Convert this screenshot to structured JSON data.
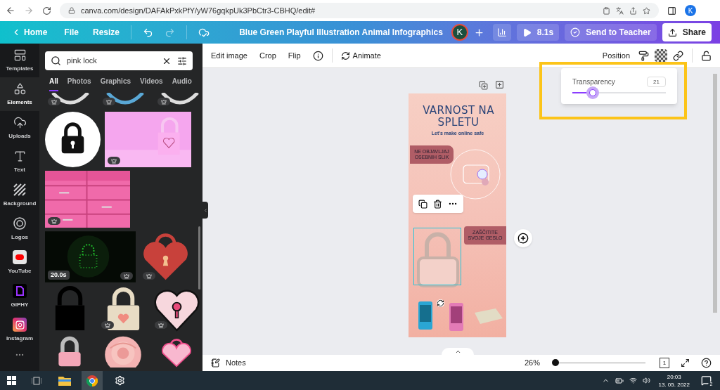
{
  "browser": {
    "url": "canva.com/design/DAFAkPxkPfY/yW76gqkpUk3PbCtr3-CBHQ/edit#",
    "profile": "K"
  },
  "topbar": {
    "home": "Home",
    "menus": [
      "File",
      "Resize"
    ],
    "title": "Blue Green Playful Illustration Animal Infographics",
    "avatar": "K",
    "duration": "8.1s",
    "send": "Send to Teacher",
    "share": "Share"
  },
  "rail": [
    {
      "label": "Templates",
      "selected": false
    },
    {
      "label": "Elements",
      "selected": true
    },
    {
      "label": "Uploads",
      "selected": false
    },
    {
      "label": "Text",
      "selected": false
    },
    {
      "label": "Background",
      "selected": false
    },
    {
      "label": "Logos",
      "selected": false
    },
    {
      "label": "YouTube",
      "selected": false
    },
    {
      "label": "GIPHY",
      "selected": false
    },
    {
      "label": "Instagram",
      "selected": false
    }
  ],
  "panel": {
    "search": {
      "value": "pink lock"
    },
    "tabs": [
      {
        "label": "All",
        "selected": true
      },
      {
        "label": "Photos",
        "selected": false
      },
      {
        "label": "Graphics",
        "selected": false
      },
      {
        "label": "Videos",
        "selected": false
      },
      {
        "label": "Audio",
        "selected": false
      }
    ],
    "rows": [
      [
        {
          "kind": "partial",
          "premium": true
        },
        {
          "kind": "partial",
          "premium": true
        },
        {
          "kind": "partial",
          "premium": true
        }
      ],
      [
        {
          "kind": "lockcircle",
          "premium": false
        },
        {
          "kind": "picture",
          "premium": true
        }
      ],
      [
        {
          "kind": "picture",
          "premium": true
        }
      ],
      [
        {
          "kind": "video",
          "premium": true,
          "duration": "20.0s"
        },
        {
          "kind": "heartlock",
          "premium": true
        }
      ],
      [
        {
          "kind": "blacklock",
          "premium": false
        },
        {
          "kind": "beigelock",
          "premium": true
        },
        {
          "kind": "heartkey",
          "premium": true
        }
      ],
      [
        {
          "kind": "pinklock",
          "premium": false
        },
        {
          "kind": "picture",
          "premium": false
        },
        {
          "kind": "pinkheart",
          "premium": false
        }
      ]
    ]
  },
  "toolbar": {
    "items": [
      "Edit image",
      "Crop",
      "Flip"
    ],
    "animate": "Animate",
    "position": "Position"
  },
  "transparency": {
    "label": "Transparency",
    "value": "21",
    "level": 0.22
  },
  "design": {
    "title": "VARNOST NA SPLETU",
    "subtitle": "Let's make online safe",
    "callout_1": "NE OBJAVLJAJ OSEBNIH SLIK",
    "callout_2": "ZAŠČITITE SVOJE GESLO"
  },
  "bottom": {
    "notes": "Notes",
    "zoom": "26%",
    "page": "1"
  },
  "taskbar": {
    "time": "20:03",
    "date": "13. 05. 2022",
    "notifications": "2"
  }
}
